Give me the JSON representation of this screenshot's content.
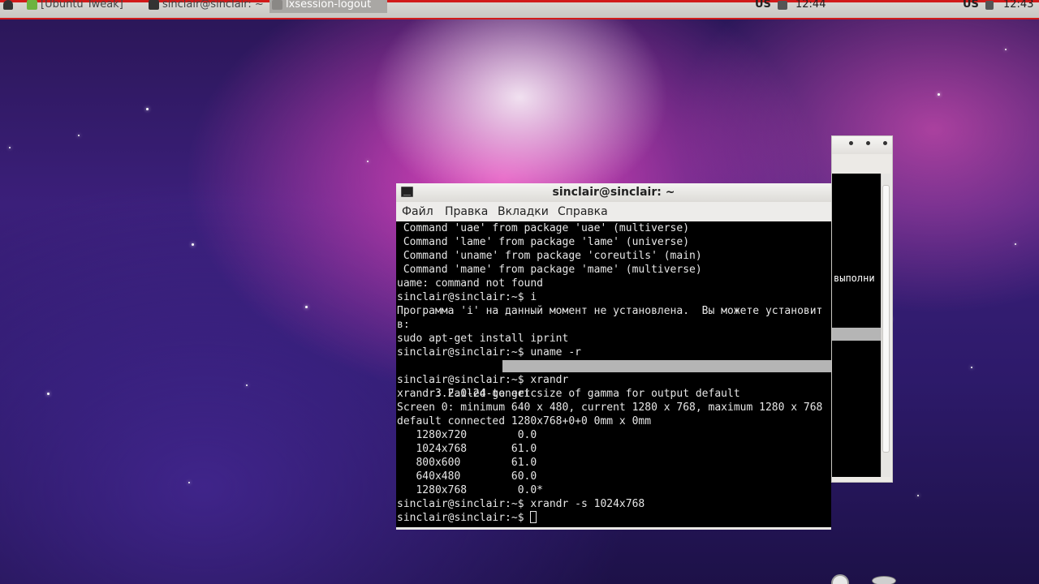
{
  "top_panel": {
    "tasks": [
      {
        "label": "[Ubuntu Tweak]",
        "active": false
      },
      {
        "label": "sinclair@sinclair: ~",
        "active": false
      },
      {
        "label": "lxsession-logout",
        "active": true
      }
    ],
    "tray_left": {
      "layout": "US",
      "clock": "12:44"
    },
    "tray_right": {
      "layout": "US",
      "clock": "12:43"
    }
  },
  "back_window": {
    "visible_text": "выполни"
  },
  "terminal": {
    "title": "sinclair@sinclair: ~",
    "menu": [
      "Файл",
      "Правка",
      "Вкладки",
      "Справка"
    ],
    "lines": [
      " Command 'uae' from package 'uae' (multiverse)",
      " Command 'lame' from package 'lame' (universe)",
      " Command 'uname' from package 'coreutils' (main)",
      " Command 'mame' from package 'mame' (multiverse)",
      "uame: command not found",
      "sinclair@sinclair:~$ i",
      "Программа 'i' на данный момент не установлена.  Вы можете установит",
      "в:",
      "sudo apt-get install iprint",
      "sinclair@sinclair:~$ uname -r",
      "3.2.0-24-generic",
      "sinclair@sinclair:~$ xrandr",
      "xrandr: Failed to get size of gamma for output default",
      "Screen 0: minimum 640 x 480, current 1280 x 768, maximum 1280 x 768",
      "default connected 1280x768+0+0 0mm x 0mm",
      "   1280x720        0.0  ",
      "   1024x768       61.0  ",
      "   800x600        61.0  ",
      "   640x480        60.0  ",
      "   1280x768        0.0*",
      "sinclair@sinclair:~$ xrandr -s 1024x768",
      "sinclair@sinclair:~$ "
    ]
  }
}
